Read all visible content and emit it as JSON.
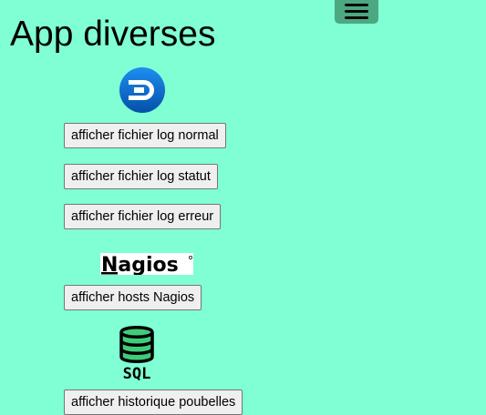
{
  "header": {
    "title": "App diverses",
    "menu_icon": "hamburger-menu-icon"
  },
  "sections": {
    "logs": {
      "logo_icon": "dynatrace-d-logo-icon",
      "buttons": [
        "afficher fichier log normal",
        "afficher fichier log statut",
        "afficher fichier log erreur"
      ]
    },
    "nagios": {
      "logo_text": "Nagios",
      "button": "afficher hosts Nagios"
    },
    "sql": {
      "logo_text": "SQL",
      "button": "afficher historique poubelles"
    }
  },
  "colors": {
    "background": "#80ffd4",
    "menu_button": "#4ca881",
    "logo_blue": "#0b6bd0"
  }
}
